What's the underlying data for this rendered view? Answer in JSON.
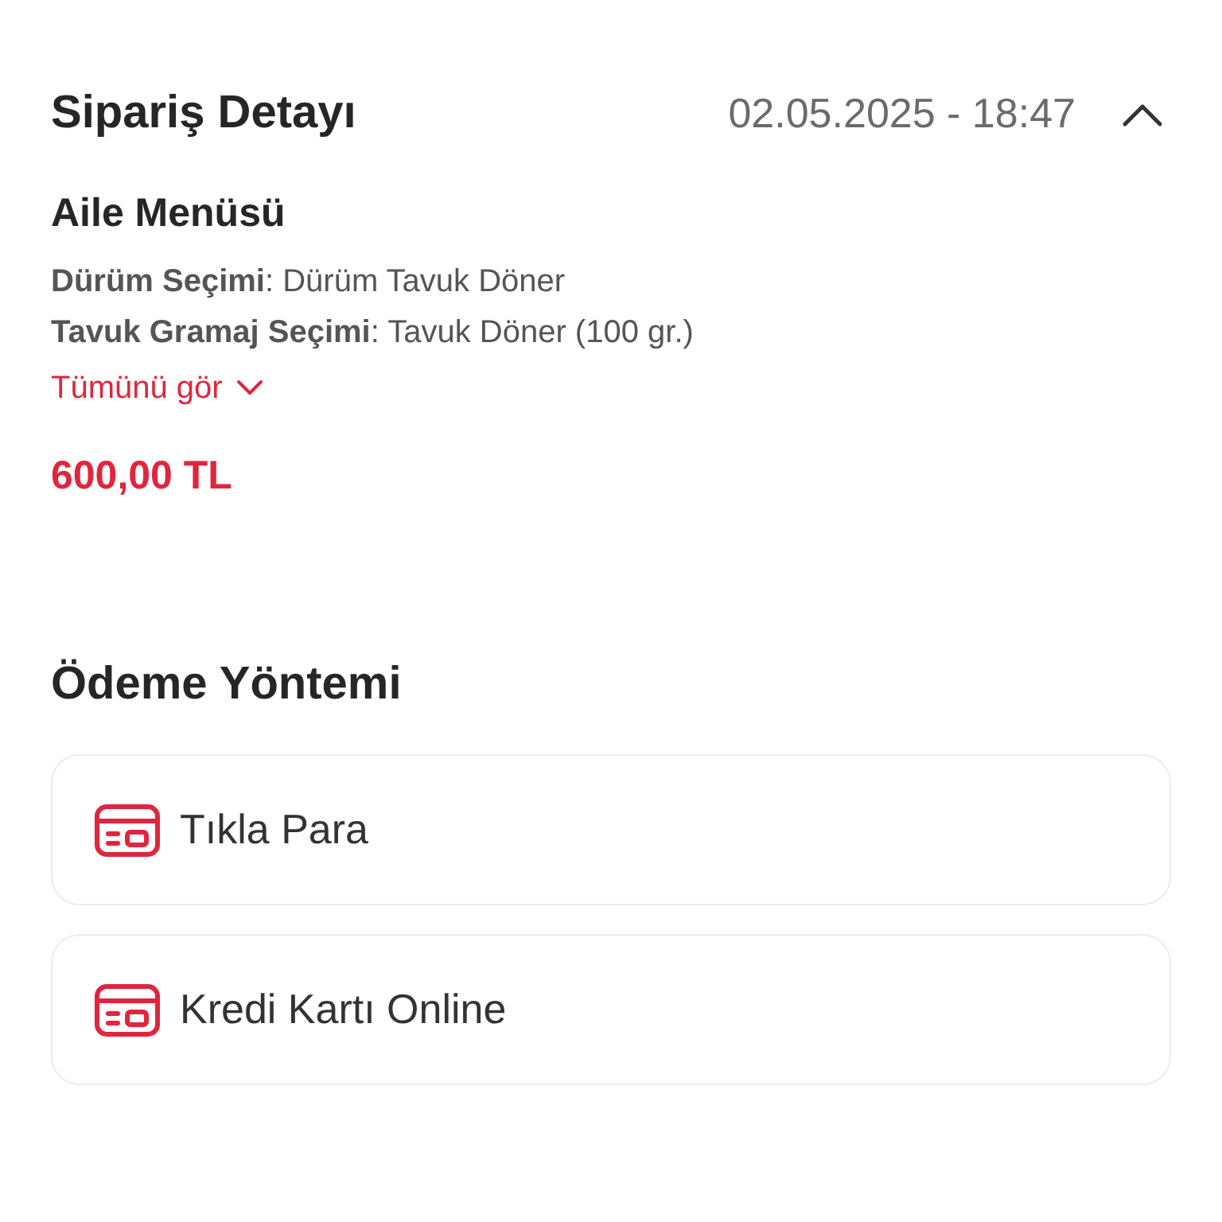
{
  "order_detail": {
    "title": "Sipariş Detayı",
    "date": "02.05.2025 - 18:47",
    "expanded": true,
    "item": {
      "name": "Aile Menüsü",
      "options": [
        {
          "label": "Dürüm Seçimi",
          "value": ": Dürüm Tavuk Döner"
        },
        {
          "label": "Tavuk Gramaj Seçimi",
          "value": ": Tavuk Döner (100 gr.)"
        }
      ],
      "show_all": "Tümünü gör",
      "price": "600,00 TL"
    }
  },
  "payment": {
    "title": "Ödeme Yöntemi",
    "methods": [
      {
        "label": "Tıkla Para"
      },
      {
        "label": "Kredi Kartı Online"
      }
    ]
  }
}
